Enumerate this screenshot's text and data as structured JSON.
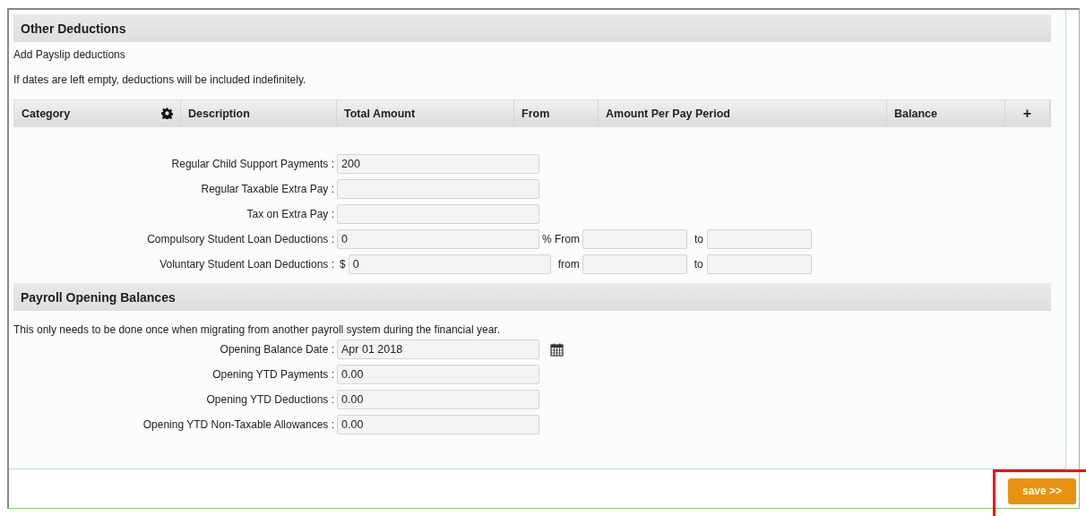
{
  "deductions": {
    "title": "Other Deductions",
    "notes": [
      "Add Payslip deductions",
      "If dates are left empty, deductions will be included indefinitely."
    ],
    "columns": [
      {
        "label": "Category",
        "kind": "settings"
      },
      {
        "label": "Description"
      },
      {
        "label": "Total Amount"
      },
      {
        "label": "From"
      },
      {
        "label": "Amount Per Pay Period"
      },
      {
        "label": "Balance"
      },
      {
        "label": "+",
        "kind": "add"
      }
    ],
    "fields": [
      {
        "label": "Regular Child Support Payments :",
        "value": "200"
      },
      {
        "label": "Regular Taxable Extra Pay :"
      },
      {
        "label": "Tax on Extra Pay :"
      },
      {
        "label": "Compulsory Student Loan Deductions :",
        "value": "0",
        "suffix": "% From",
        "to": "to"
      },
      {
        "label": "Voluntary Student Loan Deductions :",
        "prefix": "$",
        "value": "0",
        "from": "from",
        "to": "to"
      }
    ]
  },
  "opening": {
    "title": "Payroll Opening Balances",
    "note": "This only needs to be done once when migrating from another payroll system during the financial year.",
    "fields": [
      {
        "label": "Opening Balance Date :",
        "value": "Apr 01 2018",
        "kind": "date"
      },
      {
        "label": "Opening YTD Payments :",
        "value": "0.00"
      },
      {
        "label": "Opening YTD Deductions :",
        "value": "0.00"
      },
      {
        "label": "Opening YTD Non-Taxable Allowances :",
        "value": "0.00"
      }
    ]
  },
  "save_button": "save >>"
}
